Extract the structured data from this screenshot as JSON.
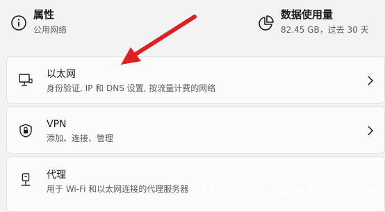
{
  "summary": {
    "properties": {
      "title": "属性",
      "subtitle": "公用网络"
    },
    "data_usage": {
      "title": "数据使用量",
      "subtitle": "82.45 GB，过去 30 天"
    }
  },
  "items": [
    {
      "title": "以太网",
      "subtitle": "身份验证, IP 和 DNS 设置, 按流量计费的网络"
    },
    {
      "title": "VPN",
      "subtitle": "添加、连接、管理"
    },
    {
      "title": "代理",
      "subtitle": "用于 Wi-Fi 和以太网连接的代理服务器"
    }
  ],
  "watermark": "IT屋博客 WenYtao.com",
  "colors": {
    "arrow": "#e02020",
    "card": "#fbfbfb",
    "background": "#f3f3f3"
  }
}
